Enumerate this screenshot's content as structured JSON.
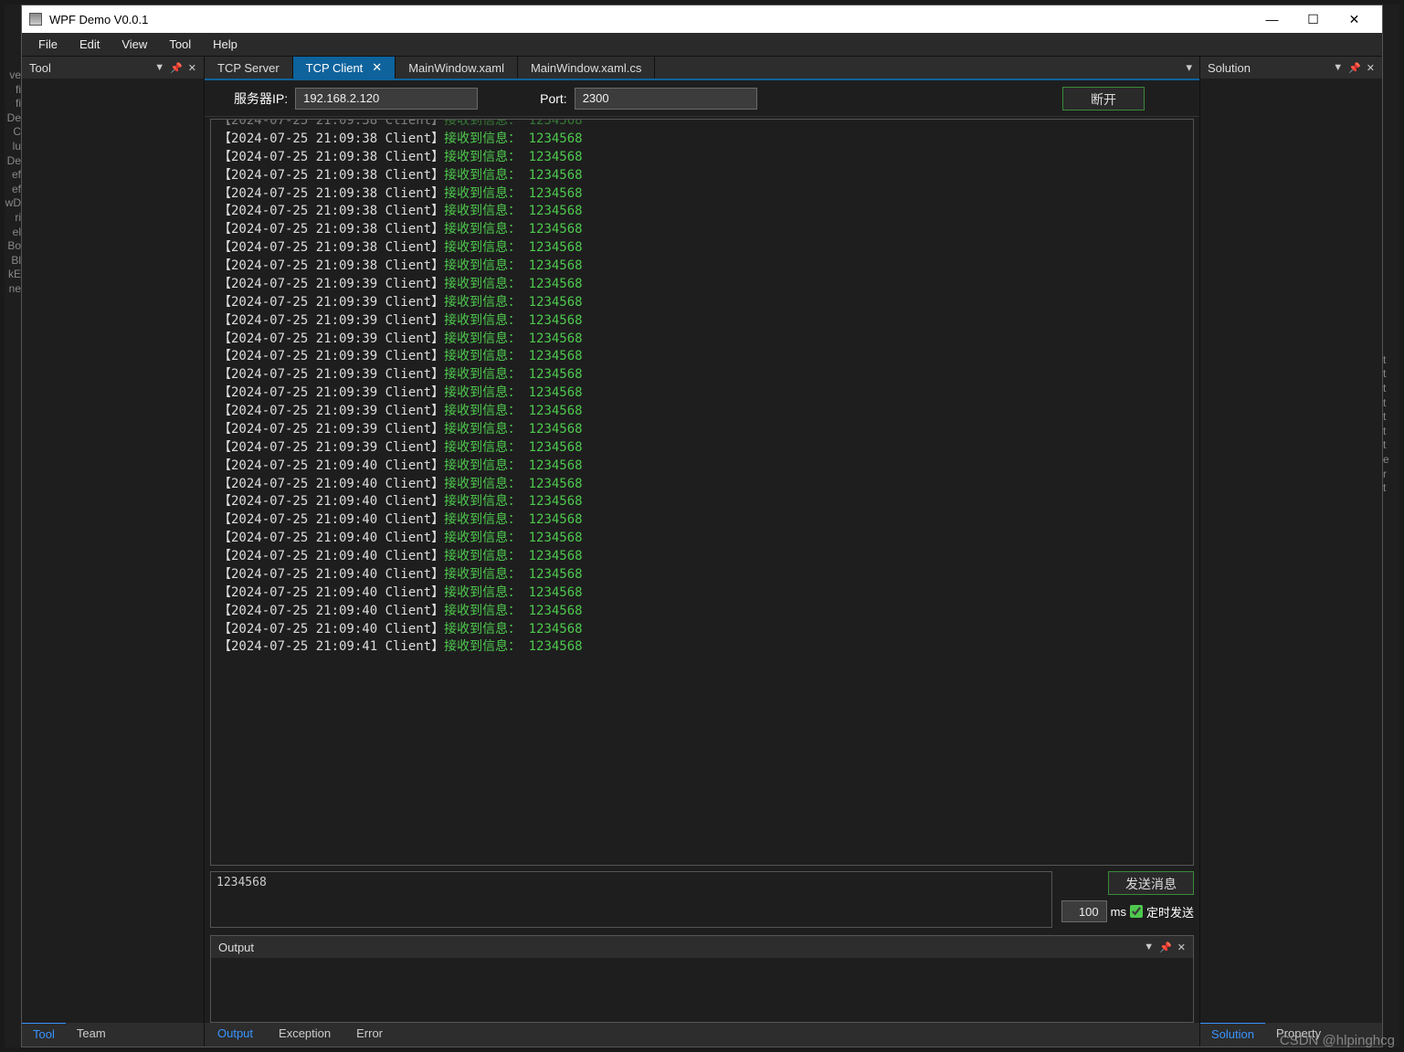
{
  "titlebar": {
    "title": "WPF Demo V0.0.1"
  },
  "menu": [
    "File",
    "Edit",
    "View",
    "Tool",
    "Help"
  ],
  "left_panel": {
    "title": "Tool"
  },
  "right_panel": {
    "title": "Solution"
  },
  "tabs": [
    {
      "label": "TCP Server",
      "active": false,
      "closable": false
    },
    {
      "label": "TCP Client",
      "active": true,
      "closable": true
    },
    {
      "label": "MainWindow.xaml",
      "active": false,
      "closable": false
    },
    {
      "label": "MainWindow.xaml.cs",
      "active": false,
      "closable": false
    }
  ],
  "conn": {
    "ip_label": "服务器IP:",
    "ip_value": "192.168.2.120",
    "port_label": "Port:",
    "port_value": "2300",
    "disconnect_label": "断开"
  },
  "log_template": {
    "prefix": "【",
    "suffix": " Client】",
    "msg": "接收到信息：",
    "data": "1234568"
  },
  "log_entries": [
    "2024-07-25 21:09:38",
    "2024-07-25 21:09:38",
    "2024-07-25 21:09:38",
    "2024-07-25 21:09:38",
    "2024-07-25 21:09:38",
    "2024-07-25 21:09:38",
    "2024-07-25 21:09:38",
    "2024-07-25 21:09:38",
    "2024-07-25 21:09:39",
    "2024-07-25 21:09:39",
    "2024-07-25 21:09:39",
    "2024-07-25 21:09:39",
    "2024-07-25 21:09:39",
    "2024-07-25 21:09:39",
    "2024-07-25 21:09:39",
    "2024-07-25 21:09:39",
    "2024-07-25 21:09:39",
    "2024-07-25 21:09:39",
    "2024-07-25 21:09:40",
    "2024-07-25 21:09:40",
    "2024-07-25 21:09:40",
    "2024-07-25 21:09:40",
    "2024-07-25 21:09:40",
    "2024-07-25 21:09:40",
    "2024-07-25 21:09:40",
    "2024-07-25 21:09:40",
    "2024-07-25 21:09:40",
    "2024-07-25 21:09:40",
    "2024-07-25 21:09:41"
  ],
  "send": {
    "text": "1234568",
    "button": "发送消息",
    "interval": "100",
    "ms": "ms",
    "timer_label": "定时发送",
    "timer_checked": true
  },
  "output": {
    "title": "Output"
  },
  "center_footer": [
    "Output",
    "Exception",
    "Error"
  ],
  "left_footer": [
    "Tool",
    "Team"
  ],
  "right_footer": [
    "Solution",
    "Property"
  ],
  "watermark": "CSDN @hlpinghcg",
  "left_code_strip": "ve\nfi\nfi\nDe\n C\nlu\nDe\nef\nef\nwD\nri\nel\nBo\nBl\nkE\nne",
  "right_code_strip": " \n \n \n \n \n \n \n \n \n \n \n \n \n \n \n \n \n \n \n \nt\nt\nt\nt\nt\nt\nt\ne\nr\nt"
}
